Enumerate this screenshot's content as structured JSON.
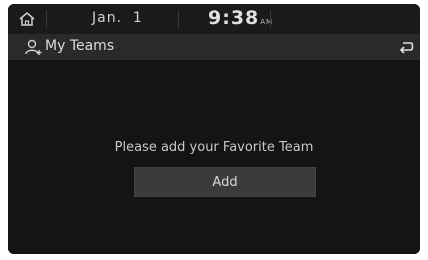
{
  "status_bar": {
    "date": "Jan.  1",
    "time": "9:38",
    "ampm": "AM"
  },
  "header": {
    "title": "My Teams"
  },
  "main": {
    "message": "Please add your Favorite Team",
    "add_label": "Add"
  },
  "icons": {
    "home": "home-icon",
    "person": "person-plus-icon",
    "back": "back-arrow-icon"
  }
}
